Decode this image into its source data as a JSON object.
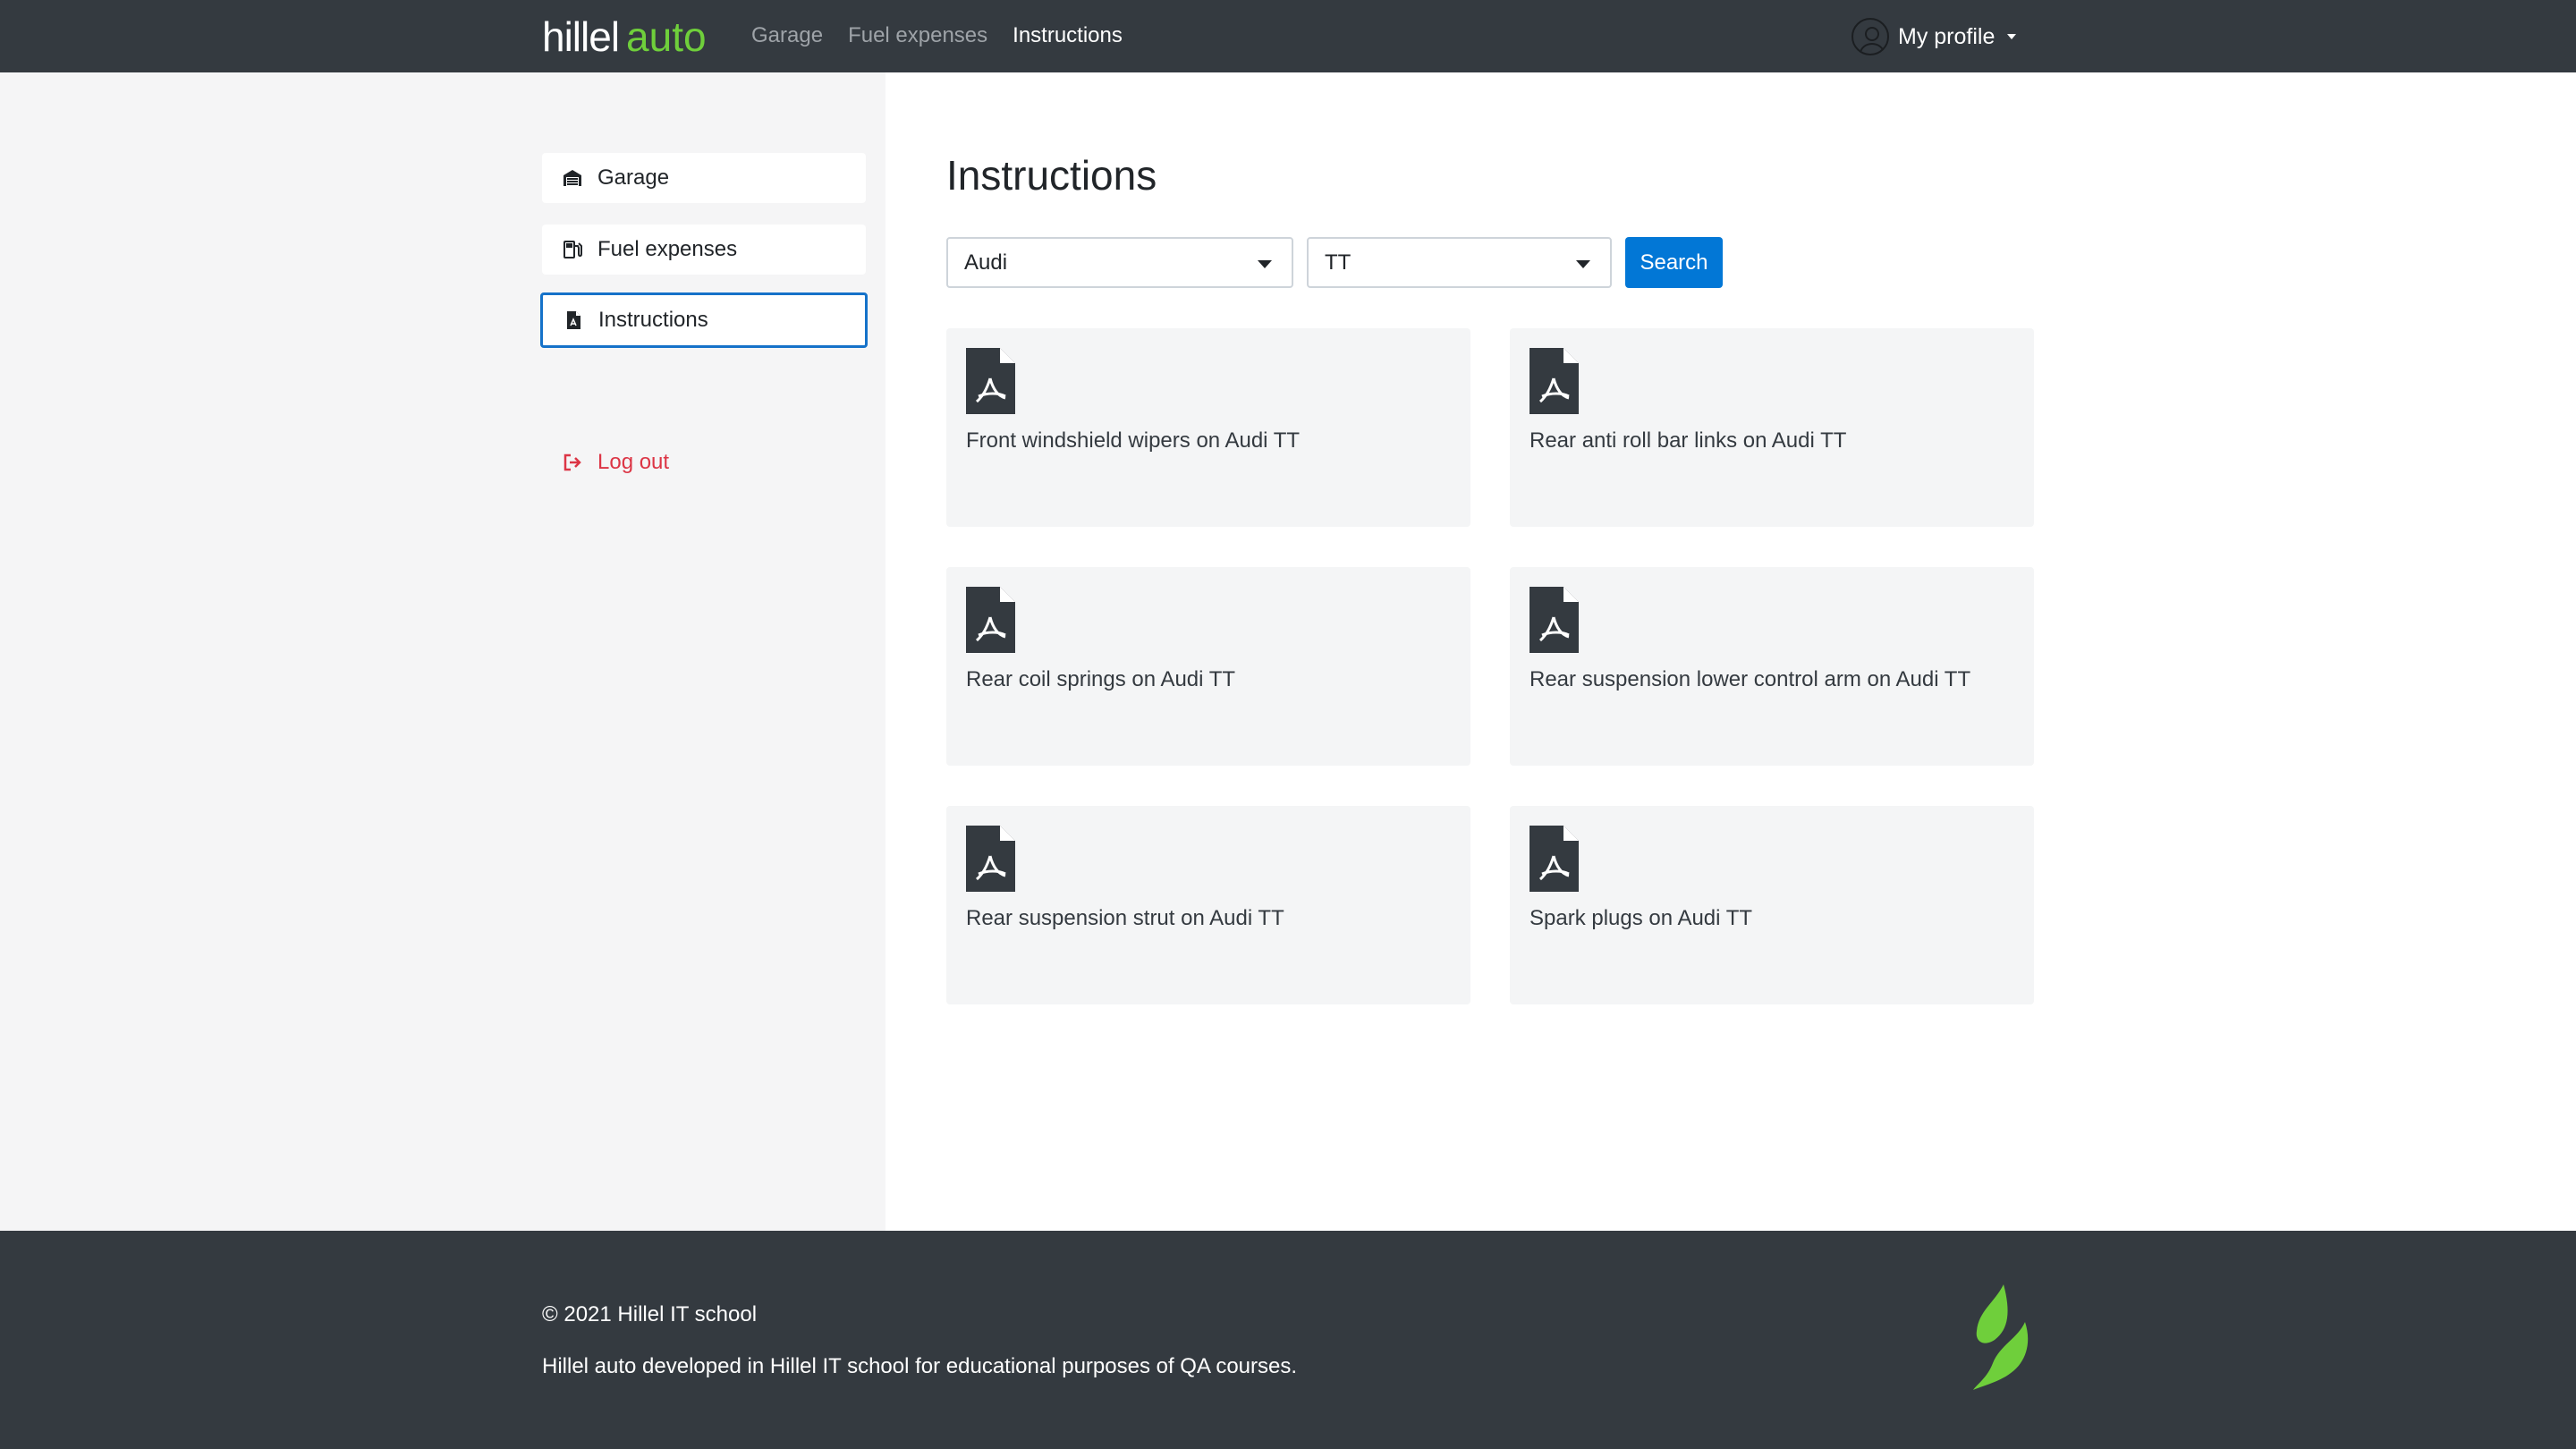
{
  "header": {
    "logo_part1": "hillel",
    "logo_part2": "auto",
    "nav": [
      {
        "label": "Garage"
      },
      {
        "label": "Fuel expenses"
      },
      {
        "label": "Instructions"
      }
    ],
    "profile_label": "My profile"
  },
  "sidebar": {
    "items": [
      {
        "label": "Garage",
        "icon": "garage-icon"
      },
      {
        "label": "Fuel expenses",
        "icon": "fuel-pump-icon"
      },
      {
        "label": "Instructions",
        "icon": "pdf-file-icon"
      }
    ],
    "logout_label": "Log out"
  },
  "main": {
    "title": "Instructions",
    "brand_select": "Audi",
    "model_select": "TT",
    "search_label": "Search",
    "cards": [
      {
        "label": "Front windshield wipers on Audi TT"
      },
      {
        "label": "Rear anti roll bar links on Audi TT"
      },
      {
        "label": "Rear coil springs on Audi TT"
      },
      {
        "label": "Rear suspension lower control arm on Audi TT"
      },
      {
        "label": "Rear suspension strut on Audi TT"
      },
      {
        "label": "Spark plugs on Audi TT"
      }
    ]
  },
  "footer": {
    "copyright": "© 2021 Hillel IT school",
    "description": "Hillel auto developed in Hillel IT school for educational purposes of QA courses."
  },
  "colors": {
    "header_bg": "#343a40",
    "accent_green": "#6fcf3b",
    "primary_blue": "#0277d6",
    "logout_red": "#dc3545"
  }
}
